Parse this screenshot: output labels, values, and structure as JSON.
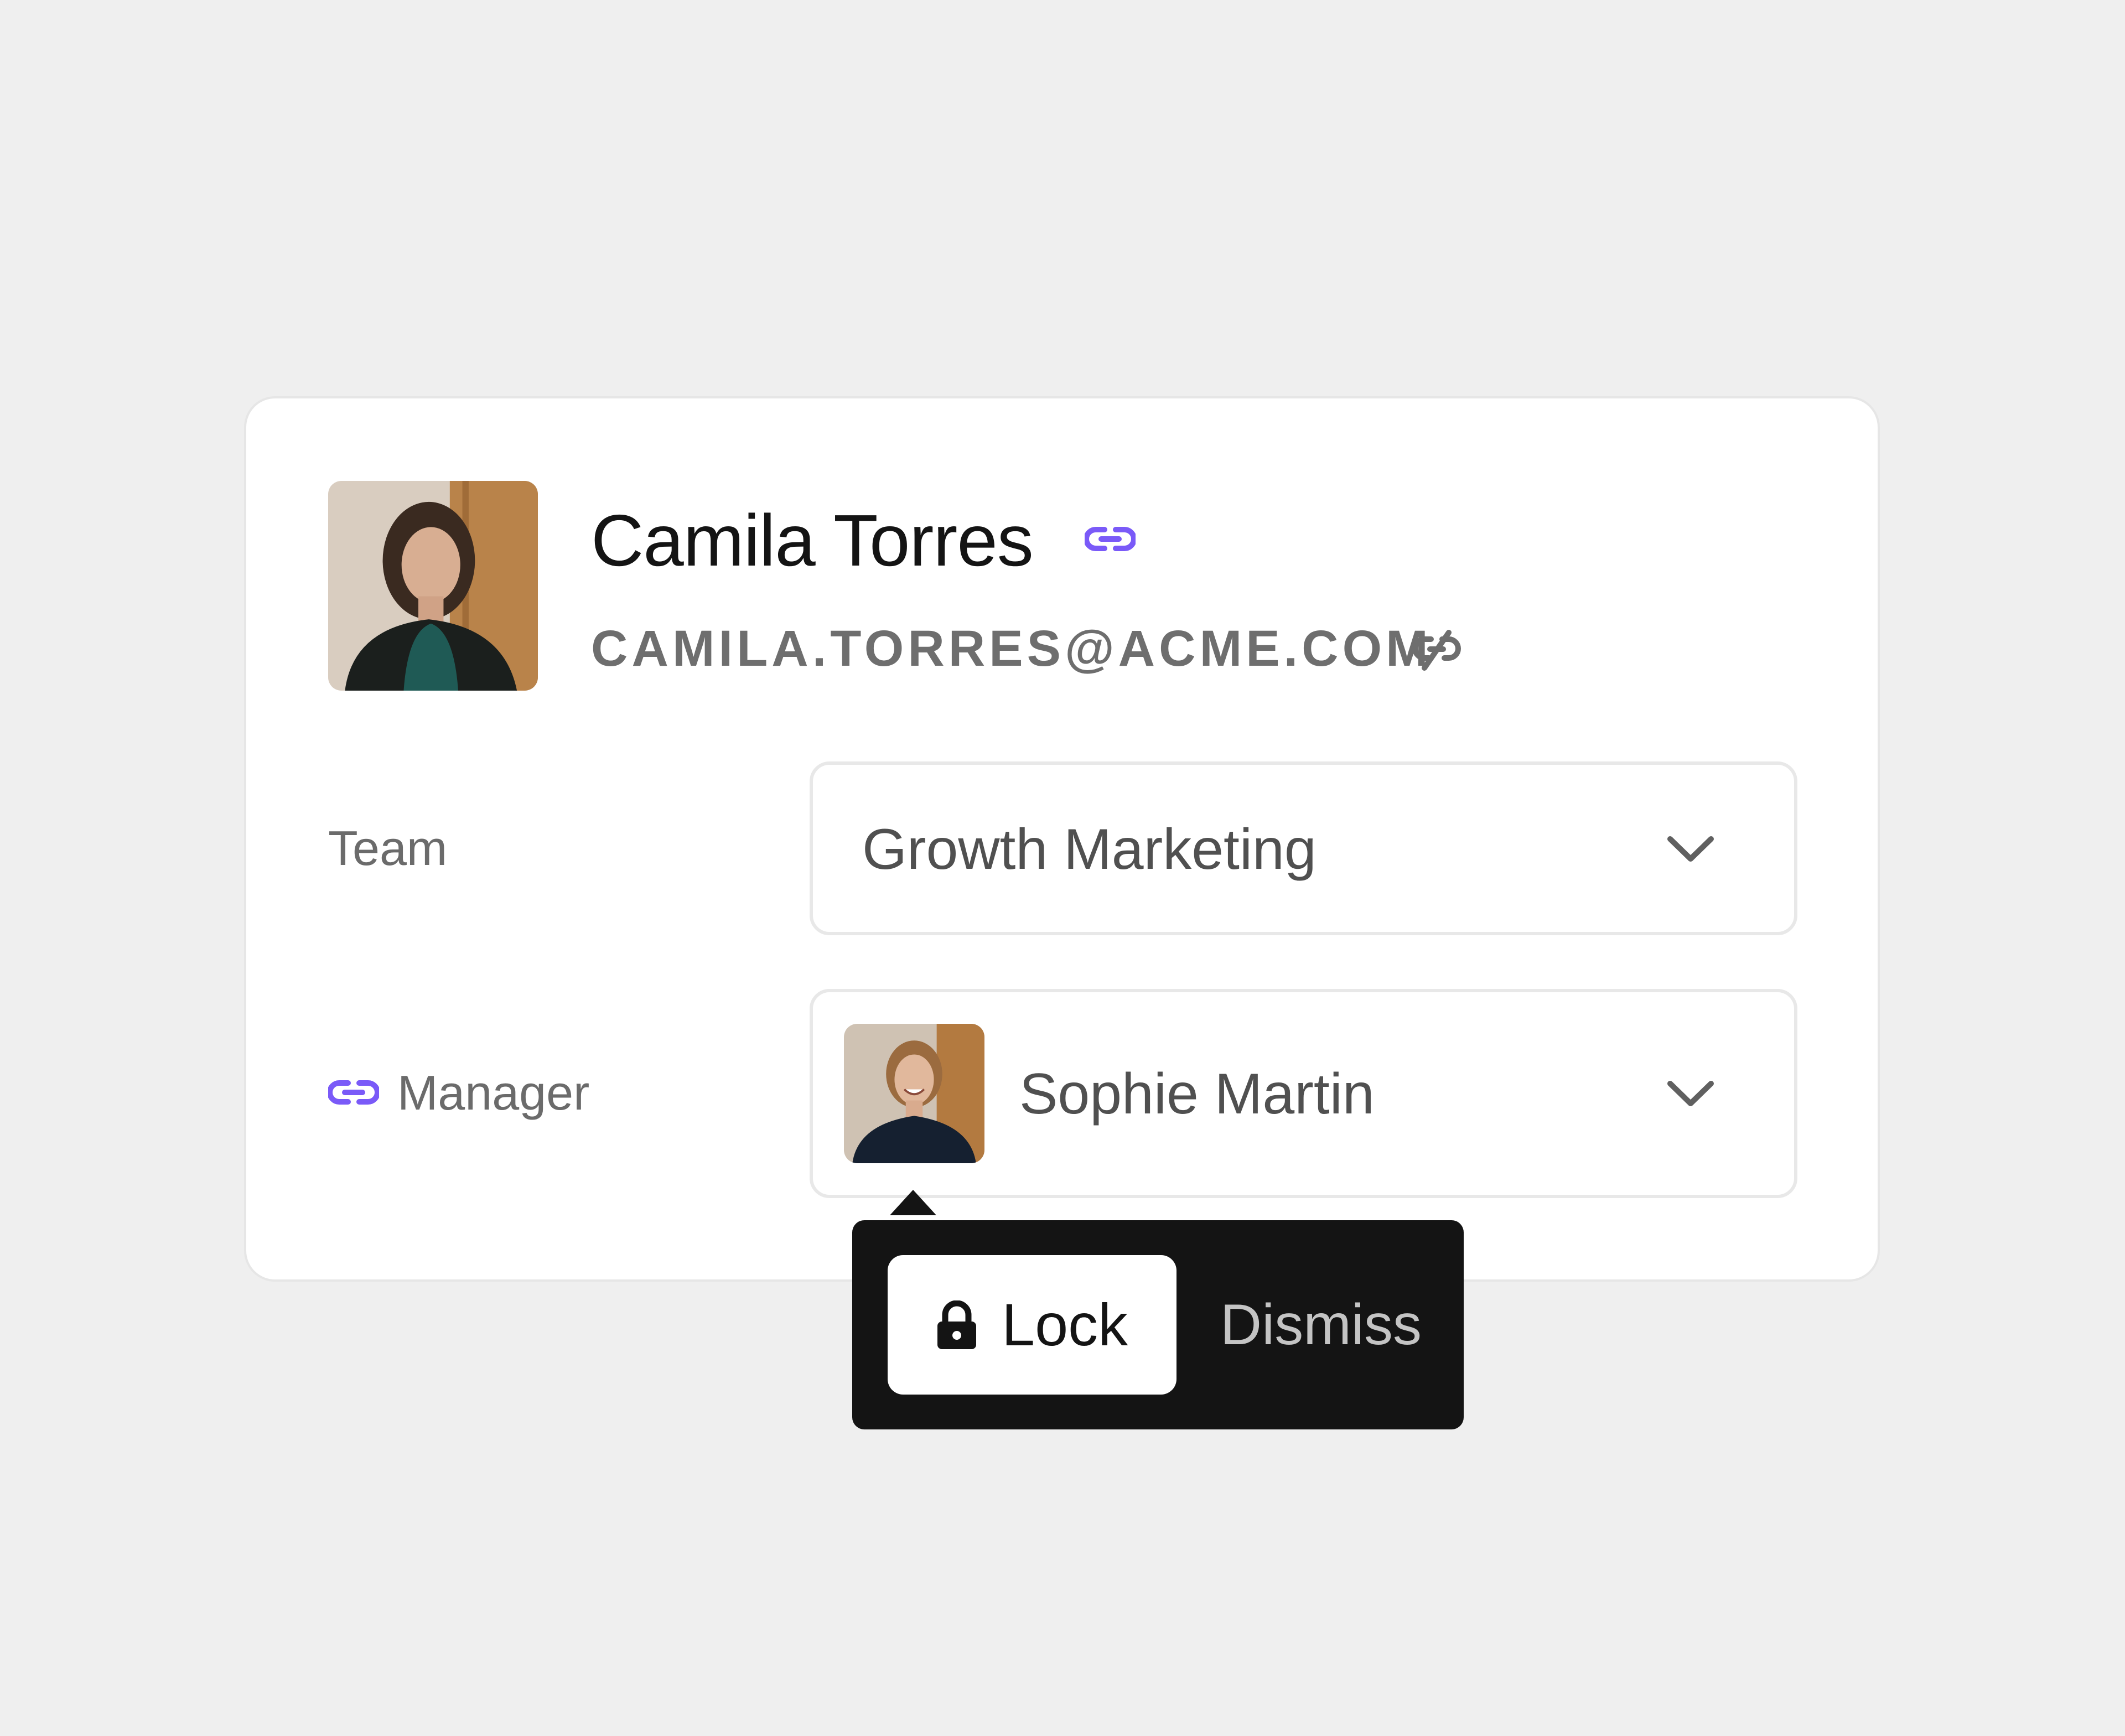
{
  "user": {
    "name": "Camila Torres",
    "email": "CAMILA.TORRES@ACME.COM",
    "avatar_icon": "user-photo",
    "name_link_icon": "link-icon",
    "email_link_icon": "link-broken-icon"
  },
  "fields": {
    "team": {
      "label": "Team",
      "value": "Growth Marketing"
    },
    "manager": {
      "label": "Manager",
      "value": "Sophie Martin",
      "label_icon": "link-icon"
    }
  },
  "popover": {
    "lock_label": "Lock",
    "dismiss_label": "Dismiss"
  },
  "colors": {
    "accent": "#7a5af8",
    "background": "#efefef",
    "popover": "#141414"
  }
}
